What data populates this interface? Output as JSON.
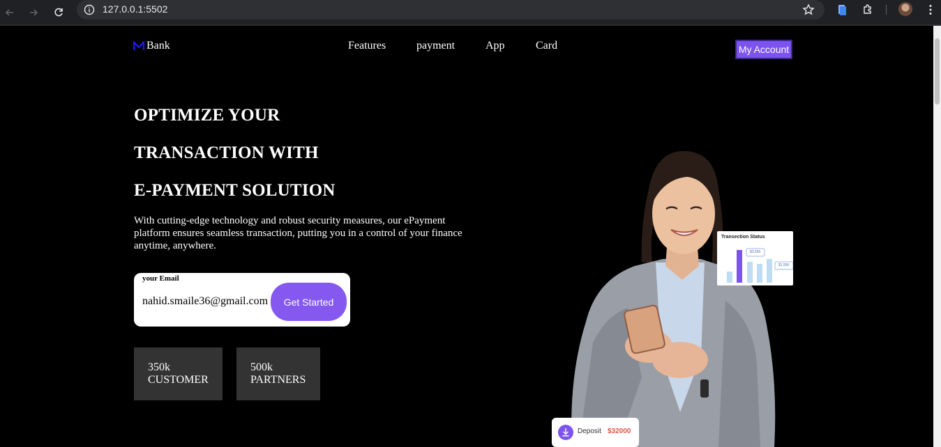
{
  "browser": {
    "url": "127.0.0.1:5502"
  },
  "nav": {
    "logo_text": "Bank",
    "logo_icon": "m-logo-icon",
    "items": [
      "Features",
      "payment",
      "App",
      "Card"
    ],
    "account_label": "My Account"
  },
  "hero": {
    "headline_lines": [
      "OPTIMIZE YOUR",
      "TRANSACTION WITH",
      "E-PAYMENT SOLUTION"
    ],
    "description": "With cutting-edge technology and robust security measures, our ePayment platform ensures seamless transaction, putting you in a control of your finance anytime, anywhere.",
    "email_label": "your Email",
    "email_value": "nahid.smaile36@gmail.com",
    "cta_label": "Get Started"
  },
  "stats": [
    {
      "value": "350k",
      "label": "CUSTOMER"
    },
    {
      "value": "500k",
      "label": "PARTNERS"
    }
  ],
  "illustration": {
    "status_card_title": "Transection Status",
    "status_tags": [
      "$3,550",
      "$1,550"
    ],
    "deposit_label": "Deposit",
    "deposit_amount": "$32000"
  },
  "colors": {
    "accent": "#7d53f0",
    "background": "#000000",
    "stat_bg": "#333333"
  }
}
